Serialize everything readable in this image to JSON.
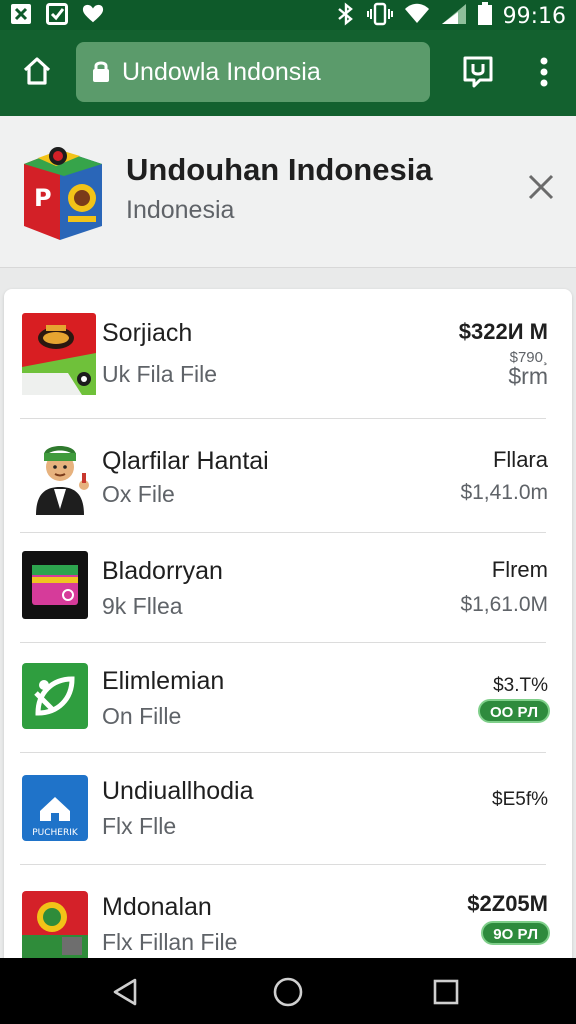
{
  "status_bar": {
    "time": "99:16",
    "left_icons": [
      "close-box-icon",
      "check-box-icon",
      "favorite-icon"
    ],
    "right_icons": [
      "bluetooth-icon",
      "vibrate-icon",
      "wifi-icon",
      "signal-icon",
      "battery-icon"
    ]
  },
  "toolbar": {
    "url": "Undowla Indonsia",
    "icons": [
      "home-icon",
      "lock-icon",
      "tab-switch-icon",
      "overflow-menu-icon"
    ]
  },
  "header": {
    "title": "Undouhan Indonesia",
    "subtitle": "Indonesia",
    "close_icon": "close-icon"
  },
  "items": [
    {
      "title": "Sorjiach",
      "subtitle": "Uk Fila File",
      "right_top": "$322И M",
      "right_bottom_small": "$790¸",
      "right_bottom": "$rm",
      "badge": ""
    },
    {
      "title": "Qlarfilar Hantai",
      "subtitle": "Ox File",
      "right_top": "Fllara",
      "right_bottom": "$1,41.0m",
      "badge": ""
    },
    {
      "title": "Bladorryan",
      "subtitle": "9k Fllea",
      "right_top": "Flrem",
      "right_bottom": "$1,61.0M",
      "badge": ""
    },
    {
      "title": "Elimlemian",
      "subtitle": "On Fille",
      "right_top": "$3.T%",
      "right_bottom": "",
      "badge": "OO PЛ"
    },
    {
      "title": "Undiuallhodia",
      "subtitle": "Flx Flle",
      "right_top": "$E5f%",
      "right_bottom": "",
      "badge": "",
      "icon_text": "PUCHERIK"
    },
    {
      "title": "Mdonalan",
      "subtitle": "Flx Fillan File",
      "right_top": "$2Z05M",
      "right_bottom": "",
      "badge": "9O PЛ"
    }
  ],
  "nav": {
    "icons": [
      "back-icon",
      "home-circle-icon",
      "recents-icon"
    ]
  },
  "colors": {
    "status_bar": "#0e5a2a",
    "app_bar": "#13612f",
    "url_field": "#5b9b6b",
    "badge": "#2e8b3d"
  }
}
